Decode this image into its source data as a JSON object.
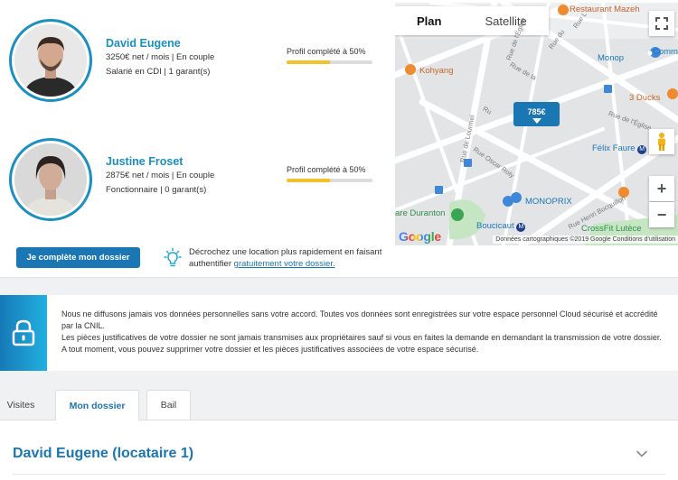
{
  "tenants": [
    {
      "name": "David Eugene",
      "income_line": "3250€ net / mois | En couple",
      "job_line": "Salarié en CDI | 1 garant(s)",
      "progress_label": "Profil complété à 50%",
      "progress": 0.5
    },
    {
      "name": "Justine Froset",
      "income_line": "2875€ net / mois | En couple",
      "job_line": "Fonctionnaire | 0 garant(s)",
      "progress_label": "Profil complété à 50%",
      "progress": 0.5
    }
  ],
  "cta": {
    "button_label": "Je complète mon dossier",
    "tip_text": "Décrochez une location plus rapidement en faisant authentifier ",
    "tip_link": "gratuitement votre dossier."
  },
  "map": {
    "tabs": [
      "Plan",
      "Satellite"
    ],
    "price_marker": "785€",
    "labels": {
      "restaurant": "Restaurant Mazeh",
      "monop": "Monop",
      "comm": "Comm",
      "kohyang": "Kohyang",
      "ducks": "3 Ducks",
      "felix": "Félix Faure",
      "monoprix": "MONOPRIX",
      "duranton": "are Duranton",
      "boucicaut": "Boucicaut",
      "crossfit": "CrossFit Lutèce"
    },
    "streets": {
      "lourmel": "Rue de Lourmel",
      "eglise": "Rue de l'Église",
      "oscar": "Rue Oscar Roty",
      "eglise2": "Rue de l'Église",
      "ru": "Ru",
      "rue_de_la": "Rue de la",
      "henri": "Rue Henri Bocquillon",
      "rue_du": "Rue du",
      "rue_l": "Rue L"
    },
    "metro_symbol": "M",
    "google": "Google",
    "footer": "Données cartographiques ©2019 Google   Conditions d'utilisation",
    "zoom_in": "+",
    "zoom_out": "−"
  },
  "notice": {
    "paragraph1": "Nous ne diffusons jamais vos données personnelles sans votre accord. Toutes vos données sont enregistrées sur votre espace personnel Cloud sécurisé et accrédité par la CNIL.",
    "paragraph2": "Les pièces justificatives de votre dossier ne sont jamais transmises aux propriétaires sauf si vous en faites la demande en demandant la transmission de votre dossier. A tout moment, vous pouvez supprimer votre dossier et les pièces justificatives associées de votre espace sécurisé."
  },
  "tabs": [
    "Visites",
    "Mon dossier",
    "Bail"
  ],
  "active_tab": "Mon dossier",
  "panel": {
    "title": "David Eugene (locataire 1)"
  },
  "colors": {
    "accent": "#1b76b4",
    "name_blue": "#1a8fc2",
    "progress": "#f2c22c"
  }
}
